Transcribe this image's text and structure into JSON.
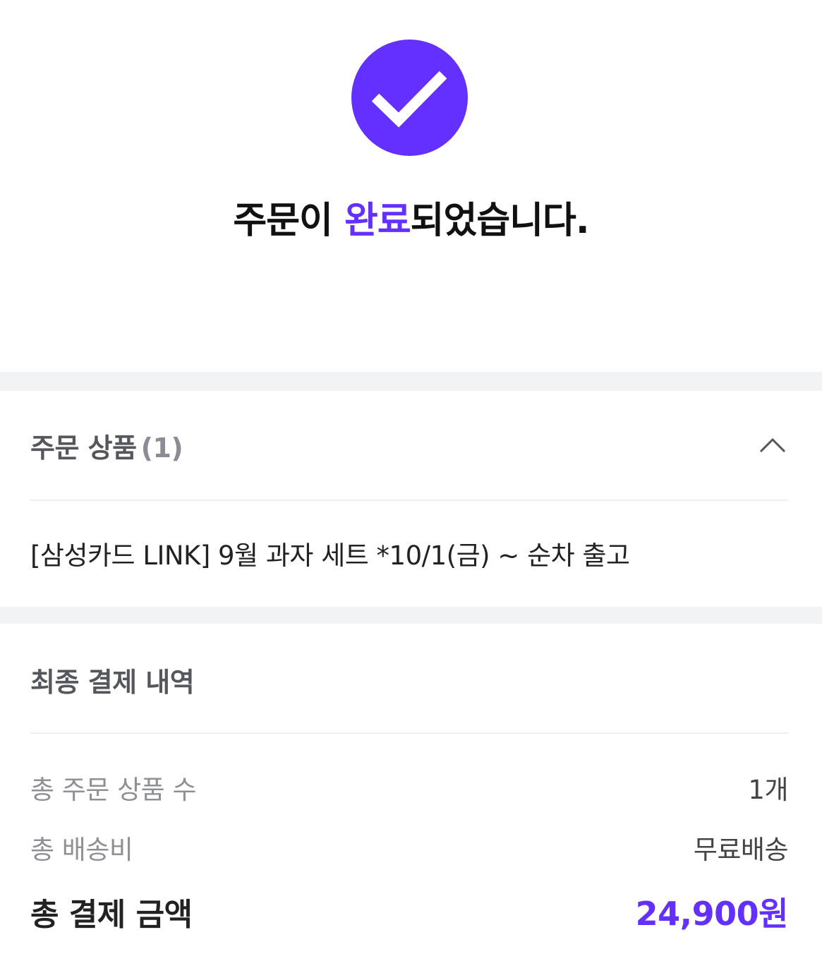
{
  "colors": {
    "accent": "#6330ff",
    "section_gap": "#f2f3f5"
  },
  "hero": {
    "icon": "check-icon",
    "title_prefix": "주문이 ",
    "title_accent": "완료",
    "title_suffix": "되었습니다."
  },
  "products": {
    "title": "주문 상품",
    "count": "(1)",
    "toggle_icon": "chevron-up-icon",
    "items": [
      {
        "name": "[삼성카드 LINK] 9월 과자 세트 *10/1(금) ~ 순차 출고"
      }
    ]
  },
  "summary": {
    "title": "최종 결제 내역",
    "rows": [
      {
        "label": "총 주문 상품 수",
        "value": "1개"
      },
      {
        "label": "총 배송비",
        "value": "무료배송"
      }
    ],
    "total": {
      "label": "총 결제 금액",
      "value": "24,900원"
    }
  }
}
